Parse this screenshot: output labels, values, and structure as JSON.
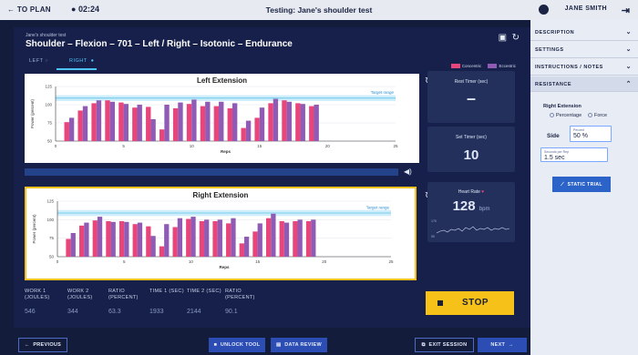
{
  "topbar": {
    "back_label": "← TO PLAN",
    "timer": "02:24",
    "title": "Testing: Jane's shoulder test",
    "user_name": "JANE SMITH"
  },
  "main": {
    "breadcrumb": "Jane's shoulder test",
    "exam_title": "Shoulder – Flexion  – 701 – Left / Right – Isotonic – Endurance",
    "tabs": [
      {
        "label": "LEFT",
        "active": false
      },
      {
        "label": "RIGHT",
        "active": true
      }
    ],
    "legend": [
      {
        "label": "Concentric",
        "color": "#e8457b"
      },
      {
        "label": "Eccentric",
        "color": "#8f5bb5"
      }
    ]
  },
  "chart_data": [
    {
      "type": "bar",
      "title": "Left Extension",
      "xlabel": "Reps",
      "ylabel": "Power (percent)",
      "xlim": [
        0,
        25
      ],
      "ylim": [
        50,
        125
      ],
      "xticks": [
        0,
        5,
        10,
        15,
        20,
        25
      ],
      "yticks": [
        50,
        75,
        100,
        125
      ],
      "target_range": {
        "label": "Target range",
        "min": 105,
        "max": 113
      },
      "series": [
        {
          "name": "Concentric",
          "color": "#e8457b",
          "x": [
            1,
            2,
            3,
            4,
            5,
            6,
            7,
            8,
            9,
            10,
            11,
            12,
            13,
            14,
            15,
            16,
            17,
            18,
            19
          ],
          "values": [
            76,
            92,
            102,
            106,
            103,
            96,
            97,
            66,
            95,
            101,
            98,
            98,
            95,
            68,
            82,
            102,
            106,
            102,
            98
          ]
        },
        {
          "name": "Eccentric",
          "color": "#8f5bb5",
          "x": [
            1,
            2,
            3,
            4,
            5,
            6,
            7,
            8,
            9,
            10,
            11,
            12,
            13,
            14,
            15,
            16,
            17,
            18,
            19
          ],
          "values": [
            82,
            98,
            106,
            104,
            101,
            100,
            80,
            100,
            103,
            107,
            104,
            104,
            102,
            78,
            96,
            108,
            104,
            101,
            100
          ]
        }
      ]
    },
    {
      "type": "bar",
      "title": "Right Extension",
      "xlabel": "Reps",
      "ylabel": "Power (percent)",
      "xlim": [
        0,
        25
      ],
      "ylim": [
        50,
        125
      ],
      "xticks": [
        0,
        5,
        10,
        15,
        20,
        25
      ],
      "yticks": [
        50,
        75,
        100,
        125
      ],
      "target_range": {
        "label": "Target range",
        "min": 105,
        "max": 113
      },
      "series": [
        {
          "name": "Concentric",
          "color": "#e8457b",
          "x": [
            1,
            2,
            3,
            4,
            5,
            6,
            7,
            8,
            9,
            10,
            11,
            12,
            13,
            14,
            15,
            16,
            17,
            18,
            19
          ],
          "values": [
            74,
            92,
            99,
            98,
            98,
            94,
            91,
            64,
            90,
            101,
            98,
            98,
            95,
            68,
            84,
            102,
            98,
            98,
            98
          ]
        },
        {
          "name": "Eccentric",
          "color": "#8f5bb5",
          "x": [
            1,
            2,
            3,
            4,
            5,
            6,
            7,
            8,
            9,
            10,
            11,
            12,
            13,
            14,
            15,
            16,
            17,
            18,
            19
          ],
          "values": [
            82,
            96,
            104,
            97,
            97,
            96,
            78,
            94,
            102,
            104,
            100,
            100,
            102,
            77,
            95,
            108,
            96,
            100,
            100
          ]
        }
      ]
    }
  ],
  "panels": {
    "rest_timer_label": "Rest Timer (sec)",
    "rest_timer_value": "–",
    "set_timer_label": "Set Timer (sec)",
    "set_timer_value": "10",
    "heart_rate_label": "Heart Rate",
    "heart_rate_value": "128",
    "heart_rate_unit": "bpm",
    "heart_ticks": [
      "170",
      "90"
    ]
  },
  "stats": [
    {
      "label": "WORK 1 (JOULES)",
      "value": "546"
    },
    {
      "label": "WORK 2 (JOULES)",
      "value": "344"
    },
    {
      "label": "RATIO (PERCENT)",
      "value": "63.3"
    },
    {
      "label": "TIME 1 (SEC)",
      "value": "1933"
    },
    {
      "label": "TIME 2 (SEC)",
      "value": "2144"
    },
    {
      "label": "RATIO (PERCENT)",
      "value": "90.1"
    }
  ],
  "stop_label": "STOP",
  "footer": {
    "previous": "PREVIOUS",
    "unlock_tool": "UNLOCK TOOL",
    "data_review": "DATA REVIEW",
    "exit_session": "EXIT SESSION",
    "next": "NEXT"
  },
  "sidebar": {
    "sections": [
      "DESCRIPTION",
      "SETTINGS",
      "INSTRUCTIONS / NOTES",
      "RESISTANCE"
    ],
    "resistance": {
      "heading": "Right Extension",
      "option_percentage": "Percentage",
      "option_force": "Force",
      "side_label": "Side",
      "percent_field_label": "Percent",
      "percent_field_value": "50  %",
      "seconds_field_label": "Seconds per Rep",
      "seconds_field_value": "1.5  sec",
      "static_trial": "STATIC TRIAL"
    }
  },
  "colors": {
    "background": "#131c3a",
    "panel": "#23305c",
    "accent": "#4fc3f7",
    "stop": "#f6c21a",
    "concentric": "#e8457b",
    "eccentric": "#8f5bb5"
  }
}
